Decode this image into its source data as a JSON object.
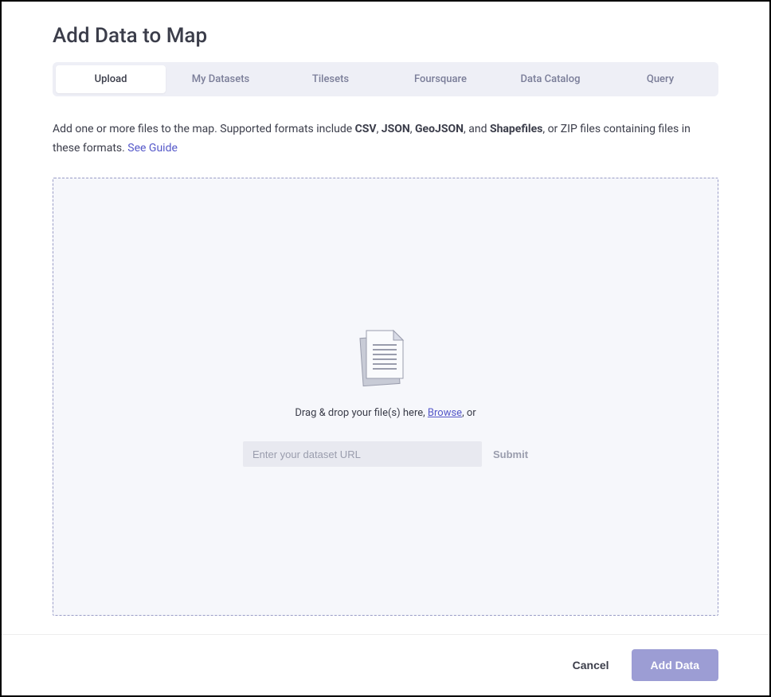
{
  "dialog": {
    "title": "Add Data to Map"
  },
  "tabs": [
    {
      "label": "Upload",
      "active": true
    },
    {
      "label": "My Datasets",
      "active": false
    },
    {
      "label": "Tilesets",
      "active": false
    },
    {
      "label": "Foursquare",
      "active": false
    },
    {
      "label": "Data Catalog",
      "active": false
    },
    {
      "label": "Query",
      "active": false
    }
  ],
  "description": {
    "prefix": "Add one or more files to the map. Supported formats include ",
    "fmt1": "CSV",
    "sep1": ", ",
    "fmt2": "JSON",
    "sep2": ", ",
    "fmt3": "GeoJSON",
    "sep3": ", and ",
    "fmt4": "Shapefiles",
    "suffix": ", or ZIP files containing files in these formats. ",
    "guide_link": "See Guide"
  },
  "dropzone": {
    "drag_text_prefix": "Drag & drop your file(s) here, ",
    "browse": "Browse",
    "drag_text_suffix": ", or",
    "url_placeholder": "Enter your dataset URL",
    "submit_label": "Submit"
  },
  "footer": {
    "cancel": "Cancel",
    "add": "Add Data"
  }
}
